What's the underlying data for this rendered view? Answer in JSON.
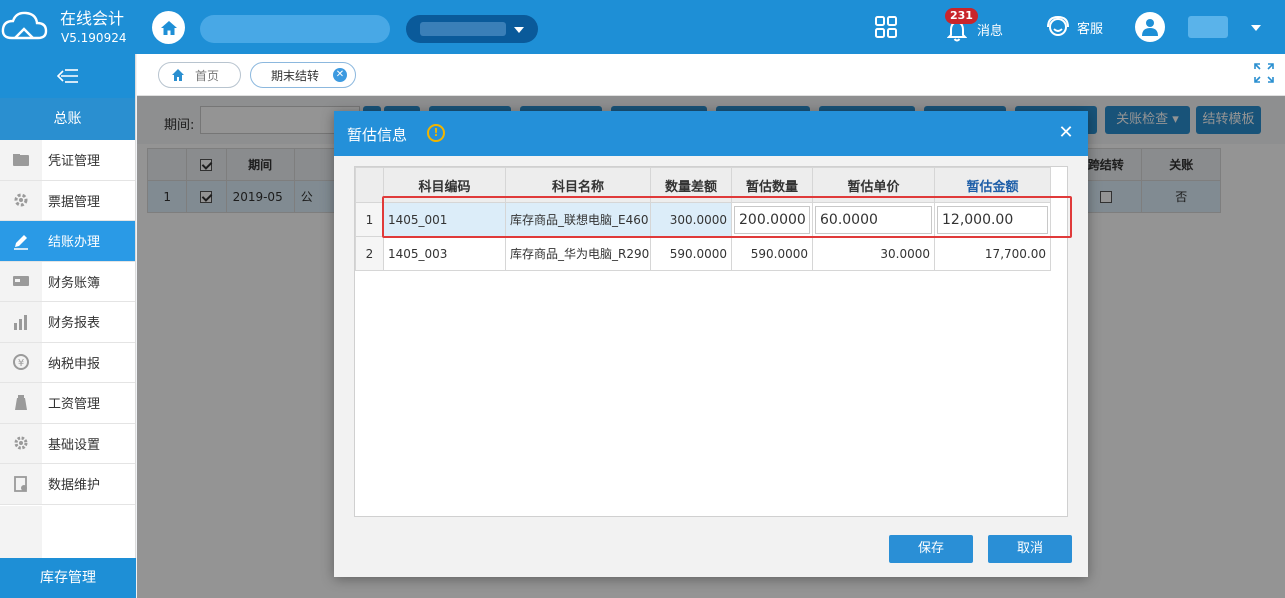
{
  "header": {
    "app_name": "在线会计",
    "version": "V5.190924",
    "message_badge": "231",
    "message_label": "消息",
    "service_label": "客服"
  },
  "sidebar": {
    "group_title": "总账",
    "items": [
      {
        "label": "凭证管理",
        "icon": "voucher-icon"
      },
      {
        "label": "票据管理",
        "icon": "invoice-icon"
      },
      {
        "label": "结账办理",
        "icon": "pen-icon",
        "active": true
      },
      {
        "label": "财务账簿",
        "icon": "ledger-icon"
      },
      {
        "label": "财务报表",
        "icon": "chart-icon"
      },
      {
        "label": "纳税申报",
        "icon": "tax-icon"
      },
      {
        "label": "工资管理",
        "icon": "salary-icon"
      },
      {
        "label": "基础设置",
        "icon": "gear-icon"
      },
      {
        "label": "数据维护",
        "icon": "database-icon"
      }
    ],
    "bottom_group": "库存管理"
  },
  "tabs": {
    "home": "首页",
    "current": "期末结转"
  },
  "background": {
    "period_label": "期间:",
    "btn_check": "关账检查",
    "btn_template": "结转模板",
    "table": {
      "headers": [
        "期间",
        "跨结转",
        "关账"
      ],
      "row": {
        "index": "1",
        "period": "2019-05",
        "short": "公",
        "closed": "否"
      }
    }
  },
  "modal": {
    "title": "暂估信息",
    "warn_icon": "!",
    "columns": [
      "科目编码",
      "科目名称",
      "数量差额",
      "暂估数量",
      "暂估单价",
      "暂估金额"
    ],
    "rows": [
      {
        "index": "1",
        "code": "1405_001",
        "name": "库存商品_联想电脑_E460",
        "qty_diff": "300.0000",
        "est_qty": "200.0000",
        "est_price": "60.0000",
        "est_amount": "12,000.00"
      },
      {
        "index": "2",
        "code": "1405_003",
        "name": "库存商品_华为电脑_R290",
        "qty_diff": "590.0000",
        "est_qty": "590.0000",
        "est_price": "30.0000",
        "est_amount": "17,700.00"
      }
    ],
    "save_label": "保存",
    "cancel_label": "取消"
  },
  "colors": {
    "primary": "#1e8fd6",
    "highlight": "#e03a3a",
    "badge": "#c9252b"
  }
}
